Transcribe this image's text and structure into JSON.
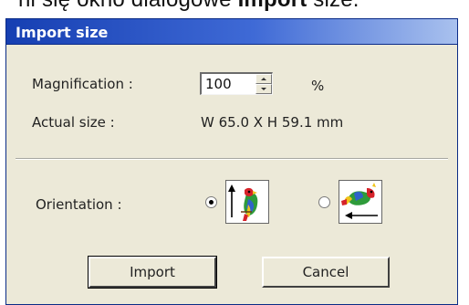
{
  "page_caption": {
    "prefix": "ni się okno dialogowe ",
    "bold": "Import",
    "suffix": " size."
  },
  "dialog": {
    "title": "Import size",
    "magnification": {
      "label": "Magnification :",
      "value": "100",
      "unit": "%"
    },
    "actual_size": {
      "label": "Actual size :",
      "value": "W 65.0 X H 59.1 mm"
    },
    "orientation": {
      "label": "Orientation :",
      "options": [
        {
          "name": "vertical",
          "icon": "parrot-vertical-icon",
          "selected": true
        },
        {
          "name": "horizontal",
          "icon": "parrot-rotated-icon",
          "selected": false
        }
      ]
    },
    "buttons": {
      "import_label": "Import",
      "cancel_label": "Cancel"
    }
  },
  "colors": {
    "dialog_bg": "#ece9d8",
    "titlebar_start": "#163fb2",
    "titlebar_end": "#a9c1ee",
    "parrot_red": "#d6232a",
    "parrot_green": "#2e9b3a",
    "parrot_yellow": "#f0c419",
    "parrot_blue": "#2f62c9"
  }
}
